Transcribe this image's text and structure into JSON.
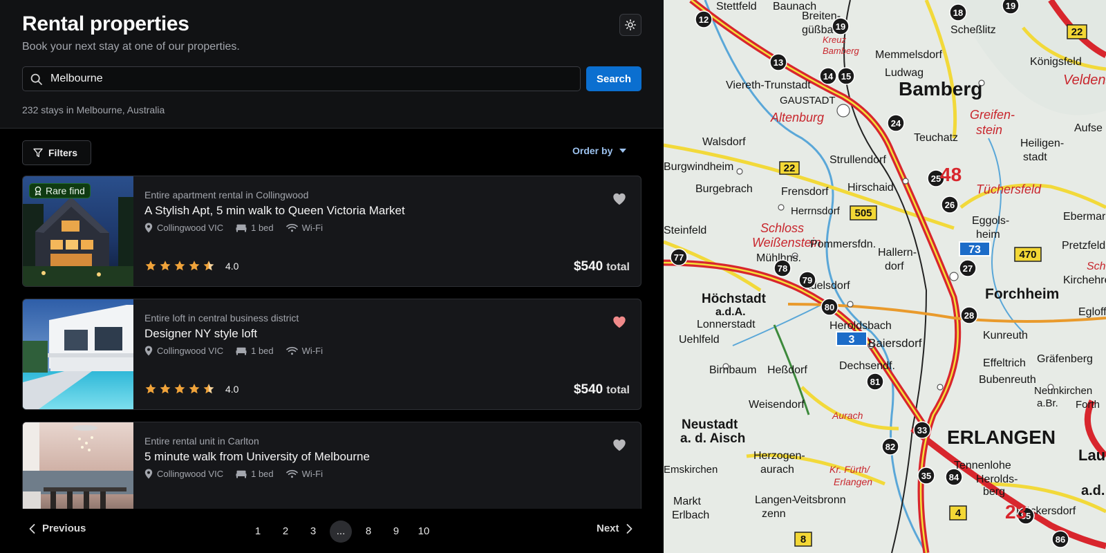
{
  "header": {
    "title": "Rental properties",
    "subtitle": "Book your next stay at one of our properties.",
    "theme_icon": "sun-icon"
  },
  "search": {
    "value": "Melbourne",
    "placeholder": "Search",
    "button_label": "Search",
    "results_text": "232 stays in Melbourne, Australia"
  },
  "toolbar": {
    "filters_label": "Filters",
    "order_by_label": "Order by"
  },
  "listings": [
    {
      "badge": "Rare find",
      "type": "Entire apartment rental in Collingwood",
      "title": "A Stylish Apt, 5 min walk to Queen Victoria Market",
      "location": "Collingwood VIC",
      "beds": "1 bed",
      "wifi": "Wi-Fi",
      "rating": "4.0",
      "stars": 4.5,
      "price": "$540",
      "price_label": "total",
      "favorited": false
    },
    {
      "badge": "",
      "type": "Entire loft in central business district",
      "title": "Designer NY style loft",
      "location": "Collingwood VIC",
      "beds": "1 bed",
      "wifi": "Wi-Fi",
      "rating": "4.0",
      "stars": 4.5,
      "price": "$540",
      "price_label": "total",
      "favorited": true
    },
    {
      "badge": "",
      "type": "Entire rental unit in Carlton",
      "title": "5 minute walk from University of Melbourne",
      "location": "Collingwood VIC",
      "beds": "1 bed",
      "wifi": "Wi-Fi",
      "favorited": false
    }
  ],
  "pagination": {
    "previous_label": "Previous",
    "next_label": "Next",
    "pages": [
      "1",
      "2",
      "3",
      "...",
      "8",
      "9",
      "10"
    ],
    "current": "..."
  },
  "map": {
    "labels": [
      "Bamberg",
      "ERLANGEN",
      "Forchheim",
      "Höchstadt",
      "a.d.A.",
      "Neustadt",
      "a. d. Aisch",
      "GAUSTADT",
      "Altenburg",
      "Greifen-",
      "stein",
      "Schloss",
      "Weißenstein",
      "Tüchersfeld",
      "Baiersdorf",
      "Heroldsbach",
      "Adelsdorf",
      "Hallern-",
      "dorf",
      "Pommersfdn.",
      "Mühlhns.",
      "Strullendorf",
      "Hirschaid",
      "Walsdorf",
      "Burgebrach",
      "Frensdorf",
      "Herrnsdorf",
      "Lonnerstadt",
      "Uehlfeld",
      "Birnbaum",
      "Heßdorf",
      "Dechsendf.",
      "Weisendorf",
      "Herzogen-",
      "aurach",
      "Langen-",
      "zenn",
      "Veitsbronn",
      "Bubenreuth",
      "Effeltrich",
      "Kunreuth",
      "Eggols-",
      "heim",
      "Teuchatz",
      "Heiligen-",
      "stadt",
      "Memmelsdorf",
      "Ludwag",
      "Scheßlitz",
      "Königsfeld",
      "Breiten-",
      "güßbach",
      "Viereth-Trunstadt",
      "Tennenlohe",
      "Herolds-",
      "berg",
      "Rückersdorf",
      "Gräfenberg",
      "Egloff",
      "Markt",
      "Erlbach",
      "Emskirchen",
      "Aurach",
      "Kr. Fürth/",
      "Erlangen",
      "Lau",
      "a.d.",
      "Ebermar",
      "Pretzfeld",
      "Kirchehren",
      "Aufse",
      "Veldenst",
      "Steinfeld",
      "Burgwindheim",
      "Neunkirchen",
      "a.Br.",
      "Forth",
      "Stettfeld",
      "Baunach",
      "Kreuz",
      "Bamberg",
      "Schwe"
    ],
    "route_numbers": [
      "12",
      "13",
      "14",
      "15",
      "18",
      "19",
      "19",
      "24",
      "25",
      "26",
      "27",
      "28",
      "33",
      "35",
      "77",
      "78",
      "79",
      "80",
      "81",
      "82",
      "84",
      "85",
      "86"
    ],
    "road_signs": [
      "22",
      "505",
      "73",
      "470",
      "3",
      "4",
      "8",
      "22"
    ],
    "region_numbers": [
      "48",
      "23"
    ]
  }
}
